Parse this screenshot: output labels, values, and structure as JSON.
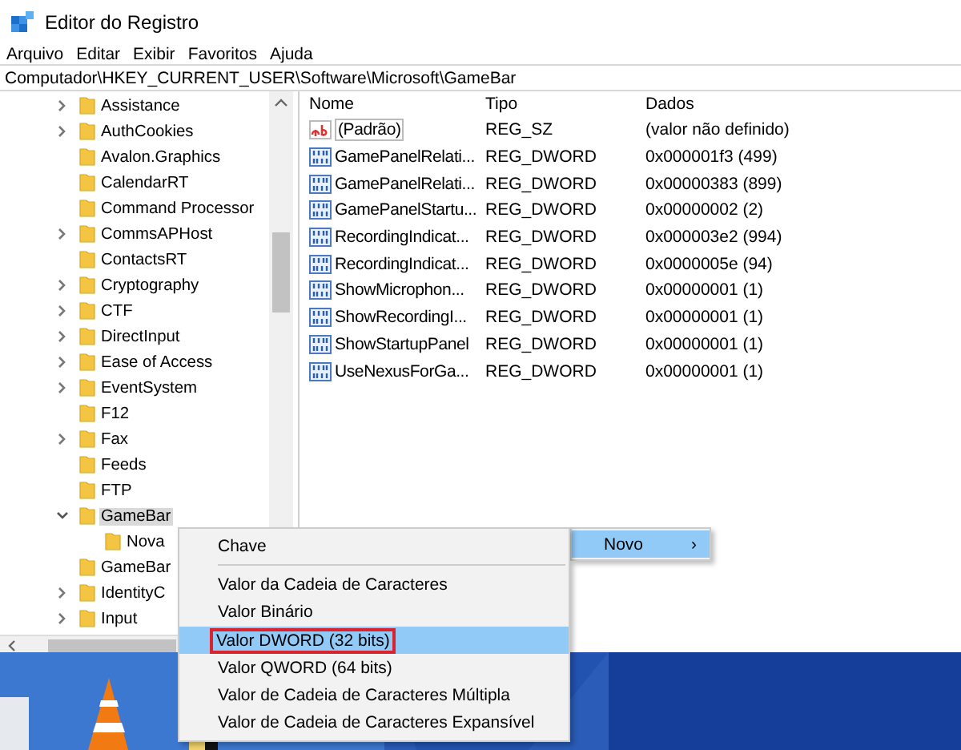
{
  "window": {
    "title": "Editor do Registro"
  },
  "menu": [
    "Arquivo",
    "Editar",
    "Exibir",
    "Favoritos",
    "Ajuda"
  ],
  "address": "Computador\\HKEY_CURRENT_USER\\Software\\Microsoft\\GameBar",
  "tree": {
    "items": [
      {
        "label": "Assistance",
        "has_children": true,
        "expanded": false,
        "selected": false
      },
      {
        "label": "AuthCookies",
        "has_children": true,
        "expanded": false,
        "selected": false
      },
      {
        "label": "Avalon.Graphics",
        "has_children": false,
        "selected": false
      },
      {
        "label": "CalendarRT",
        "has_children": false,
        "selected": false
      },
      {
        "label": "Command Processor",
        "has_children": false,
        "selected": false
      },
      {
        "label": "CommsAPHost",
        "has_children": true,
        "expanded": false,
        "selected": false
      },
      {
        "label": "ContactsRT",
        "has_children": false,
        "selected": false
      },
      {
        "label": "Cryptography",
        "has_children": true,
        "expanded": false,
        "selected": false
      },
      {
        "label": "CTF",
        "has_children": true,
        "expanded": false,
        "selected": false
      },
      {
        "label": "DirectInput",
        "has_children": true,
        "expanded": false,
        "selected": false
      },
      {
        "label": "Ease of Access",
        "has_children": true,
        "expanded": false,
        "selected": false
      },
      {
        "label": "EventSystem",
        "has_children": true,
        "expanded": false,
        "selected": false
      },
      {
        "label": "F12",
        "has_children": false,
        "selected": false
      },
      {
        "label": "Fax",
        "has_children": true,
        "expanded": false,
        "selected": false
      },
      {
        "label": "Feeds",
        "has_children": false,
        "selected": false
      },
      {
        "label": "FTP",
        "has_children": false,
        "selected": false
      },
      {
        "label": "GameBar",
        "has_children": true,
        "expanded": true,
        "selected": true,
        "children": [
          {
            "label": "Nova",
            "has_children": false,
            "selected": false
          }
        ]
      },
      {
        "label": "GameBar",
        "has_children": false,
        "selected": false
      },
      {
        "label": "IdentityC",
        "has_children": true,
        "expanded": false,
        "selected": false
      },
      {
        "label": "Input",
        "has_children": true,
        "expanded": false,
        "selected": false
      }
    ]
  },
  "values": {
    "columns": [
      "Nome",
      "Tipo",
      "Dados"
    ],
    "rows": [
      {
        "kind": "string",
        "name": "(Padrão)",
        "type": "REG_SZ",
        "data": "(valor não definido)",
        "focused": true
      },
      {
        "kind": "dword",
        "name": "GamePanelRelati...",
        "type": "REG_DWORD",
        "data": "0x000001f3 (499)",
        "focused": false
      },
      {
        "kind": "dword",
        "name": "GamePanelRelati...",
        "type": "REG_DWORD",
        "data": "0x00000383 (899)",
        "focused": false
      },
      {
        "kind": "dword",
        "name": "GamePanelStartu...",
        "type": "REG_DWORD",
        "data": "0x00000002 (2)",
        "focused": false
      },
      {
        "kind": "dword",
        "name": "RecordingIndicat...",
        "type": "REG_DWORD",
        "data": "0x000003e2 (994)",
        "focused": false
      },
      {
        "kind": "dword",
        "name": "RecordingIndicat...",
        "type": "REG_DWORD",
        "data": "0x0000005e (94)",
        "focused": false
      },
      {
        "kind": "dword",
        "name": "ShowMicrophon...",
        "type": "REG_DWORD",
        "data": "0x00000001 (1)",
        "focused": false
      },
      {
        "kind": "dword",
        "name": "ShowRecordingI...",
        "type": "REG_DWORD",
        "data": "0x00000001 (1)",
        "focused": false
      },
      {
        "kind": "dword",
        "name": "ShowStartupPanel",
        "type": "REG_DWORD",
        "data": "0x00000001 (1)",
        "focused": false
      },
      {
        "kind": "dword",
        "name": "UseNexusForGa...",
        "type": "REG_DWORD",
        "data": "0x00000001 (1)",
        "focused": false
      }
    ]
  },
  "context_menu": {
    "items": [
      {
        "label": "Novo",
        "selected": true,
        "has_submenu": true,
        "submenu_arrow": "›"
      }
    ]
  },
  "submenu": {
    "groups": [
      {
        "items": [
          {
            "label": "Chave",
            "selected": false,
            "outlined": false
          }
        ]
      },
      {
        "items": [
          {
            "label": "Valor da Cadeia de Caracteres",
            "selected": false,
            "outlined": false
          },
          {
            "label": "Valor Binário",
            "selected": false,
            "outlined": false
          },
          {
            "label": "Valor DWORD (32 bits)",
            "selected": true,
            "outlined": true
          },
          {
            "label": "Valor QWORD (64 bits)",
            "selected": false,
            "outlined": false
          },
          {
            "label": "Valor de Cadeia de Caracteres Múltipla",
            "selected": false,
            "outlined": false
          },
          {
            "label": "Valor de Cadeia de Caracteres Expansível",
            "selected": false,
            "outlined": false
          }
        ]
      }
    ]
  },
  "desktop": {
    "kind": "picture"
  }
}
